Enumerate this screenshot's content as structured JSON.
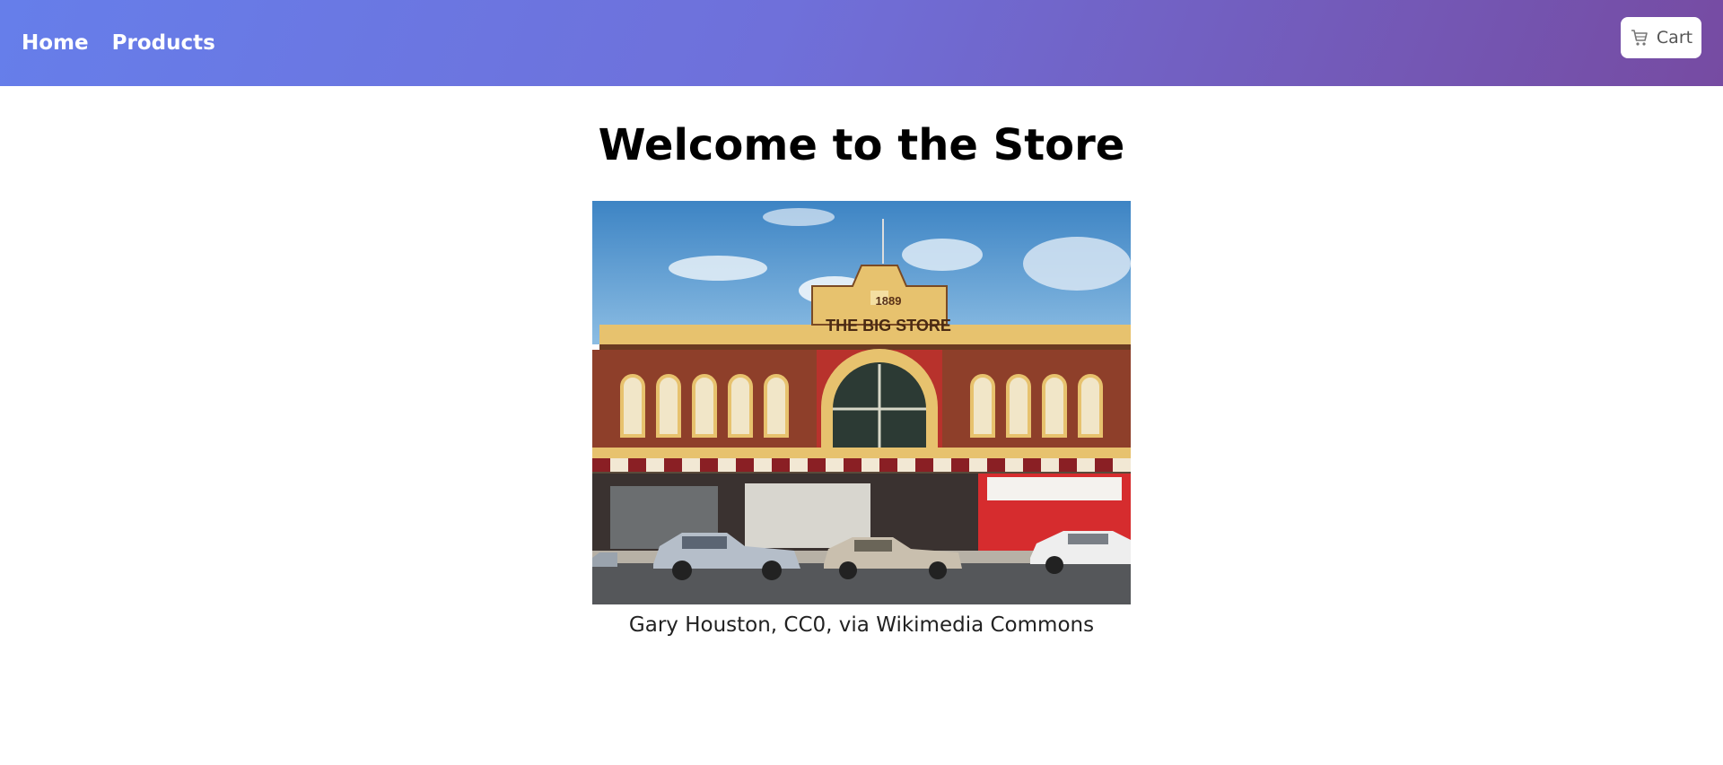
{
  "nav": {
    "links": [
      {
        "label": "Home"
      },
      {
        "label": "Products"
      }
    ],
    "cart_label": "Cart",
    "gradient_start": "#667eea",
    "gradient_end": "#764ba2"
  },
  "main": {
    "title": "Welcome to the Store",
    "image": {
      "sign_year": "1889",
      "sign_text": "THE BIG STORE",
      "caption": "Gary Houston, CC0, via Wikimedia Commons"
    }
  }
}
